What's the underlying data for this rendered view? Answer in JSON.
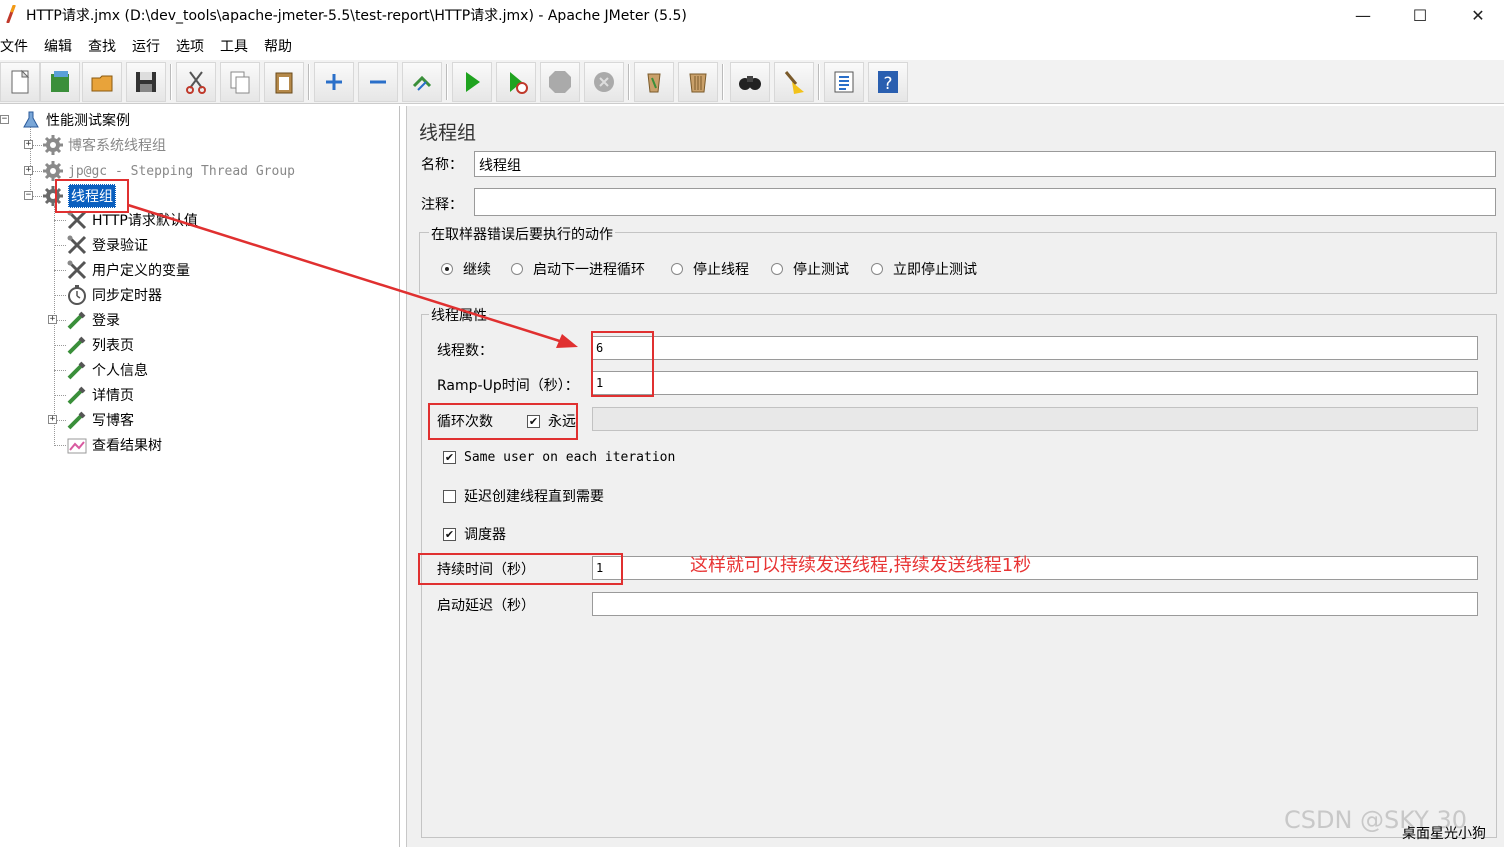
{
  "window": {
    "title": "HTTP请求.jmx (D:\\dev_tools\\apache-jmeter-5.5\\test-report\\HTTP请求.jmx) - Apache JMeter (5.5)",
    "minimize": "—",
    "maximize": "☐",
    "close": "✕"
  },
  "menu": [
    "文件",
    "编辑",
    "查找",
    "运行",
    "选项",
    "工具",
    "帮助"
  ],
  "toolbar": [
    "new-icon",
    "templates-icon",
    "open-icon",
    "save-icon",
    "cut-icon",
    "copy-icon",
    "paste-icon",
    "expand-icon",
    "collapse-icon",
    "toggle-icon",
    "start-icon",
    "start-no-pause-icon",
    "stop-icon",
    "shutdown-icon",
    "clear-icon",
    "clear-all-icon",
    "search-icon",
    "reset-search-icon",
    "function-helper-icon",
    "help-icon"
  ],
  "tree": {
    "root": "性能测试案例",
    "items": [
      {
        "label": "博客系统线程组"
      },
      {
        "label": "jp@gc - Stepping Thread Group"
      },
      {
        "label": "线程组"
      },
      {
        "label": "HTTP请求默认值"
      },
      {
        "label": "登录验证"
      },
      {
        "label": "用户定义的变量"
      },
      {
        "label": "同步定时器"
      },
      {
        "label": "登录"
      },
      {
        "label": "列表页"
      },
      {
        "label": "个人信息"
      },
      {
        "label": "详情页"
      },
      {
        "label": "写博客"
      },
      {
        "label": "查看结果树"
      }
    ]
  },
  "panel": {
    "title": "线程组",
    "name_label": "名称：",
    "name_value": "线程组",
    "comment_label": "注释：",
    "comment_value": "",
    "error_group_title": "在取样器错误后要执行的动作",
    "error_actions": [
      "继续",
      "启动下一进程循环",
      "停止线程",
      "停止测试",
      "立即停止测试"
    ],
    "selected_action": 0,
    "props_title": "线程属性",
    "threads_label": "线程数：",
    "threads_value": "6",
    "rampup_label": "Ramp-Up时间（秒）：",
    "rampup_value": "1",
    "loop_label": "循环次数",
    "forever_label": "永远",
    "loop_value": "",
    "same_user_label": "Same user on each iteration",
    "delay_create_label": "延迟创建线程直到需要",
    "scheduler_label": "调度器",
    "duration_label": "持续时间（秒）",
    "duration_value": "1",
    "startup_delay_label": "启动延迟（秒）",
    "startup_delay_value": ""
  },
  "checks": {
    "forever": true,
    "same_user": true,
    "delay_create": false,
    "scheduler": true
  },
  "annotation": {
    "text": "这样就可以持续发送线程,持续发送线程1秒",
    "color": "#e83434"
  },
  "watermark": {
    "text": "CSDN @SKY 30",
    "caption": "桌面星光小狗"
  }
}
